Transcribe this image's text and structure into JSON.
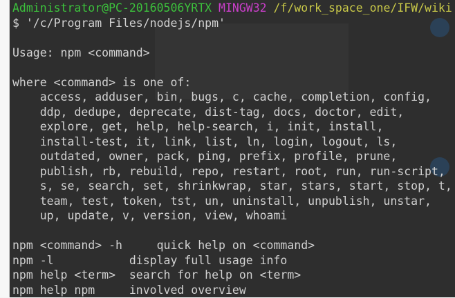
{
  "prompt": {
    "user_host": "Administrator@PC-20160506YRTX",
    "system": "MINGW32",
    "path": "/f/work_space_one/IFW/wiki"
  },
  "command_line": "$ '/c/Program Files/nodejs/npm'",
  "output": [
    "",
    "Usage: npm <command>",
    "",
    "where <command> is one of:",
    "    access, adduser, bin, bugs, c, cache, completion, config,",
    "    ddp, dedupe, deprecate, dist-tag, docs, doctor, edit,",
    "    explore, get, help, help-search, i, init, install,",
    "    install-test, it, link, list, ln, login, logout, ls,",
    "    outdated, owner, pack, ping, prefix, profile, prune,",
    "    publish, rb, rebuild, repo, restart, root, run, run-script,",
    "    s, se, search, set, shrinkwrap, star, stars, start, stop, t,",
    "    team, test, token, tst, un, uninstall, unpublish, unstar,",
    "    up, update, v, version, view, whoami",
    "",
    "npm <command> -h     quick help on <command>",
    "npm -l           display full usage info",
    "npm help <term>  search for help on <term>",
    "npm help npm     involved overview"
  ],
  "colors": {
    "background": "#2e2e2e",
    "text": "#d2d2d2",
    "user_host": "#3cc23c",
    "system": "#c93fc9",
    "path": "#c8c848"
  }
}
